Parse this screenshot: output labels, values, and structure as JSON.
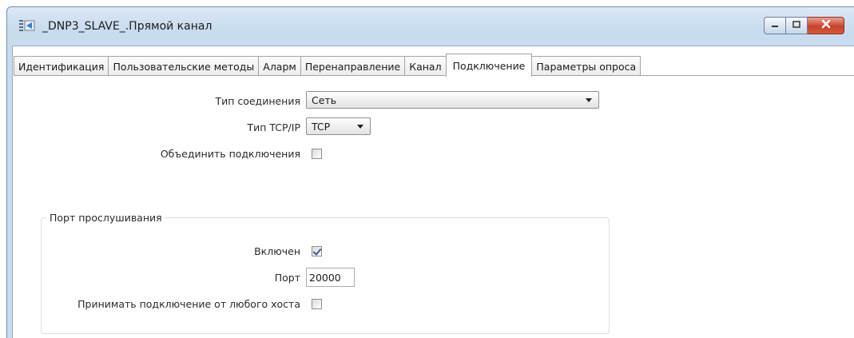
{
  "window": {
    "title": "_DNP3_SLAVE_.Прямой канал",
    "icon": "channel-icon",
    "buttons": {
      "minimize": "minimize-icon",
      "maximize": "maximize-icon",
      "close": "close-icon"
    }
  },
  "tabs": [
    {
      "label": "Идентификация",
      "active": false
    },
    {
      "label": "Пользовательские методы",
      "active": false
    },
    {
      "label": "Аларм",
      "active": false
    },
    {
      "label": "Перенаправление",
      "active": false
    },
    {
      "label": "Канал",
      "active": false
    },
    {
      "label": "Подключение",
      "active": true
    },
    {
      "label": "Параметры опроса",
      "active": false
    }
  ],
  "connection": {
    "type_label": "Тип соединения",
    "type_value": "Сеть",
    "tcpip_label": "Тип TCP/IP",
    "tcpip_value": "TCP",
    "merge_label": "Объединить подключения",
    "merge_checked": false
  },
  "listen_port": {
    "group_title": "Порт прослушивания",
    "enabled_label": "Включен",
    "enabled_checked": true,
    "port_label": "Порт",
    "port_value": "20000",
    "any_host_label": "Принимать подключение от любого хоста",
    "any_host_checked": false
  },
  "colors": {
    "titlebar": "#c9dbef",
    "close_button": "#c7432c",
    "check_mark": "#3a5c9c"
  }
}
